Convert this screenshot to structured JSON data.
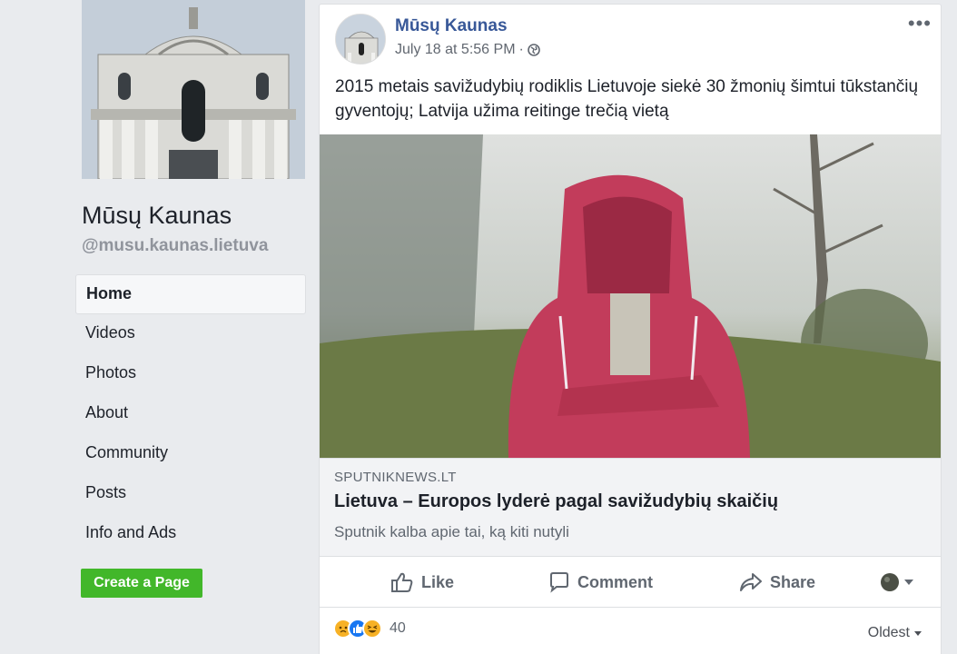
{
  "page": {
    "name": "Mūsų Kaunas",
    "handle": "@musu.kaunas.lietuva"
  },
  "nav": {
    "items": [
      {
        "label": "Home",
        "active": true
      },
      {
        "label": "Videos"
      },
      {
        "label": "Photos"
      },
      {
        "label": "About"
      },
      {
        "label": "Community"
      },
      {
        "label": "Posts"
      },
      {
        "label": "Info and Ads"
      }
    ],
    "create_page_label": "Create a Page"
  },
  "post": {
    "author": "Mūsų Kaunas",
    "timestamp": "July 18 at 5:56 PM",
    "separator": "·",
    "privacy_icon": "globe-icon",
    "more_label": "•••",
    "text": "2015 metais savižudybių rodiklis Lietuvoje siekė 30 žmonių šimtui tūkstančių gyventojų; Latvija užima reitinge trečią vietą",
    "link": {
      "domain": "SPUTNIKNEWS.LT",
      "title": "Lietuva – Europos lyderė pagal savižudybių skaičių",
      "description": "Sputnik kalba apie tai, ką kiti nutyli"
    }
  },
  "actions": {
    "like": "Like",
    "comment": "Comment",
    "share": "Share"
  },
  "reactions": {
    "types": [
      "sad",
      "like",
      "haha"
    ],
    "count": "40",
    "sort_label": "Oldest"
  },
  "colors": {
    "brand_link": "#385898",
    "create_button": "#42b72a",
    "like_blue": "#1877f2",
    "reaction_yellow": "#f7b125"
  }
}
